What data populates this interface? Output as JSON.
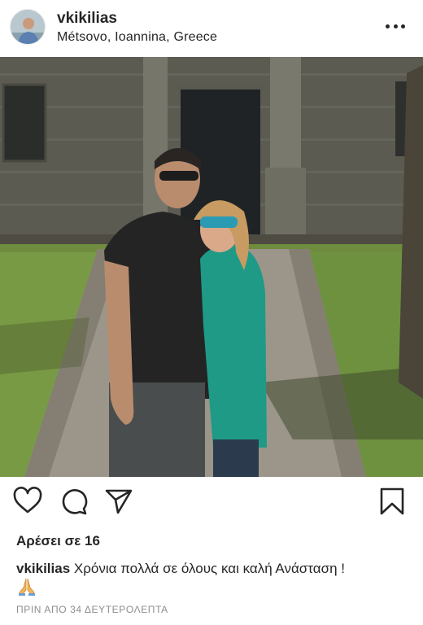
{
  "post": {
    "username": "vkikilias",
    "location": "Métsovo, Ioannina, Greece",
    "likes_text": "Αρέσει σε 16",
    "caption_user": "vkikilias",
    "caption_text": "Χρόνια πολλά σε όλους και καλή Ανάσταση !",
    "caption_emoji": "praying-hands-emoji",
    "timestamp": "ΠΡΙΝ ΑΠΟ 34 ΔΕΥΤΕΡΟΛΕΠΤΑ"
  },
  "icons": {
    "more": "more-options-icon",
    "like": "heart-icon",
    "comment": "comment-icon",
    "share": "paper-plane-icon",
    "save": "bookmark-icon"
  },
  "colors": {
    "text": "#262626",
    "secondary_text": "#8e8e8e",
    "background": "#ffffff"
  }
}
